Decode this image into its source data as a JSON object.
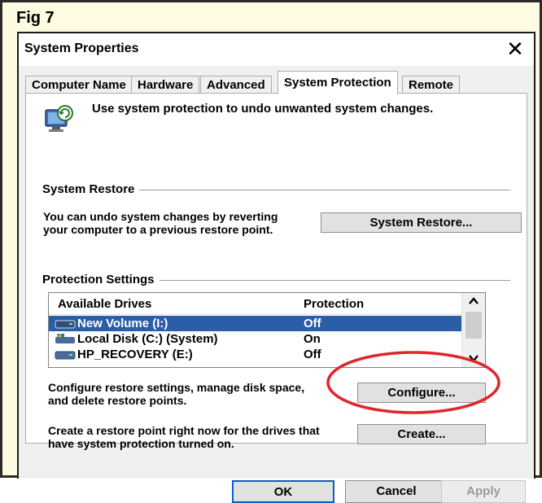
{
  "figure_label": "Fig 7",
  "window": {
    "title": "System Properties",
    "close_label": "✕"
  },
  "tabs": [
    {
      "label": "Computer Name",
      "active": false
    },
    {
      "label": "Hardware",
      "active": false
    },
    {
      "label": "Advanced",
      "active": false
    },
    {
      "label": "System Protection",
      "active": true
    },
    {
      "label": "Remote",
      "active": false
    }
  ],
  "description": "Use system protection to undo unwanted system changes.",
  "system_restore": {
    "group_label": "System Restore",
    "text_line1": "You can undo system changes by reverting",
    "text_line2": "your computer to a previous restore point.",
    "button_label": "System Restore..."
  },
  "protection_settings": {
    "group_label": "Protection Settings",
    "columns": [
      "Available Drives",
      "Protection"
    ],
    "drives": [
      {
        "name": "New Volume (I:)",
        "protection": "Off",
        "selected": true,
        "icon": "drive-icon"
      },
      {
        "name": "Local Disk (C:) (System)",
        "protection": "On",
        "selected": false,
        "icon": "system-drive-icon"
      },
      {
        "name": "HP_RECOVERY (E:)",
        "protection": "Off",
        "selected": false,
        "icon": "drive-icon"
      }
    ],
    "configure_line1": "Configure restore settings, manage disk space,",
    "configure_line2": "and delete restore points.",
    "configure_label": "Configure...",
    "create_line1": "Create a restore point right now for the drives that",
    "create_line2": "have system protection turned on.",
    "create_label": "Create..."
  },
  "footer": {
    "ok_label": "OK",
    "cancel_label": "Cancel",
    "apply_label": "Apply",
    "apply_enabled": false
  },
  "colors": {
    "selection": "#2b5ea8",
    "highlight_circle": "#e0262b",
    "figure_background": "#fffbe0"
  }
}
